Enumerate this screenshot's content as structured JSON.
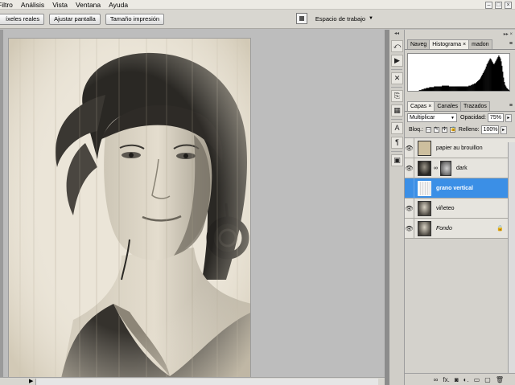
{
  "menu": [
    "Filtro",
    "Análisis",
    "Vista",
    "Ventana",
    "Ayuda"
  ],
  "window_controls": [
    "–",
    "□",
    "×"
  ],
  "options_bar": {
    "buttons": [
      "íxeles reales",
      "Ajustar pantalla",
      "Tamaño impresión"
    ],
    "workspace_label": "Espacio de trabajo",
    "workspace_caret": "▼"
  },
  "toolstrip": {
    "collapse": "◂◂",
    "icons": [
      "navigator-icon",
      "actions-icon",
      "tools-icon",
      "clone-icon",
      "swatches-icon",
      "character-icon",
      "paragraph-icon",
      "layer-comps-icon"
    ],
    "glyphs": [
      "⤺",
      "▶",
      "✕",
      "⎘",
      "▦",
      "A",
      "¶",
      "▣"
    ]
  },
  "top_panel": {
    "tabs": [
      {
        "label": "Naveg",
        "active": false
      },
      {
        "label": "Histograma",
        "active": true,
        "close": "×"
      },
      {
        "label": "madon",
        "active": false
      }
    ],
    "menu_glyph": "≡",
    "collapse_glyph": "▸▸ ×"
  },
  "layers_panel": {
    "tabs": [
      {
        "label": "Capas",
        "active": true,
        "close": "×"
      },
      {
        "label": "Canales",
        "active": false
      },
      {
        "label": "Trazados",
        "active": false
      }
    ],
    "menu_glyph": "≡",
    "blend_mode": "Multiplicar",
    "opacity_label": "Opacidad:",
    "opacity_value": "75%",
    "lock_label": "Bloq.:",
    "fill_label": "Relleno:",
    "fill_value": "100%",
    "lock_glyphs": [
      "□",
      "✎",
      "✢",
      "🔒"
    ],
    "arrow_glyph": "▸",
    "eye_glyph": "👁",
    "chain_glyph": "∞",
    "layer_lock_glyph": "🔒",
    "layers": [
      {
        "name": "papier au brouillon",
        "thumb": "paper",
        "selected": false,
        "mask": false,
        "italic": false,
        "locked": false
      },
      {
        "name": "dark",
        "thumb": "dark",
        "selected": false,
        "mask": true,
        "italic": false,
        "locked": false
      },
      {
        "name": "grano vertical",
        "thumb": "grain",
        "selected": true,
        "mask": false,
        "italic": false,
        "locked": false
      },
      {
        "name": "viñeteo",
        "thumb": "portrait",
        "selected": false,
        "mask": false,
        "italic": false,
        "locked": false
      },
      {
        "name": "Fondo",
        "thumb": "portrait",
        "selected": false,
        "mask": false,
        "italic": true,
        "locked": true
      }
    ],
    "bottom_icons": [
      "link-icon",
      "fx-icon",
      "mask-icon",
      "adjustment-icon",
      "group-icon",
      "new-layer-icon",
      "trash-icon"
    ],
    "bottom_glyphs": [
      "∞",
      "fx.",
      "◙",
      "◐.",
      "▭",
      "▢",
      "🗑"
    ]
  },
  "status": {
    "arrow": "▶"
  },
  "histogram": {
    "bins": [
      0,
      0,
      0,
      0,
      0,
      0,
      0,
      0,
      0,
      0,
      0,
      0,
      0,
      0,
      1,
      1,
      1,
      2,
      2,
      2,
      3,
      3,
      3,
      4,
      4,
      4,
      4,
      5,
      5,
      5,
      5,
      5,
      5,
      6,
      6,
      6,
      6,
      6,
      6,
      6,
      6,
      6,
      6,
      7,
      7,
      7,
      7,
      7,
      7,
      7,
      7,
      7,
      6,
      6,
      6,
      6,
      6,
      6,
      6,
      6,
      6,
      6,
      6,
      6,
      6,
      6,
      6,
      6,
      6,
      6,
      6,
      6,
      6,
      6,
      6,
      6,
      6,
      7,
      7,
      7,
      8,
      8,
      9,
      9,
      10,
      10,
      11,
      12,
      13,
      14,
      15,
      16,
      18,
      20,
      22,
      24,
      26,
      28,
      30,
      33,
      36,
      38,
      40,
      42,
      44,
      43,
      41,
      39,
      37,
      36,
      38,
      40,
      42,
      44,
      46,
      48,
      46,
      44,
      40,
      34,
      26,
      18,
      12,
      8,
      6,
      4,
      3,
      2,
      1
    ]
  }
}
